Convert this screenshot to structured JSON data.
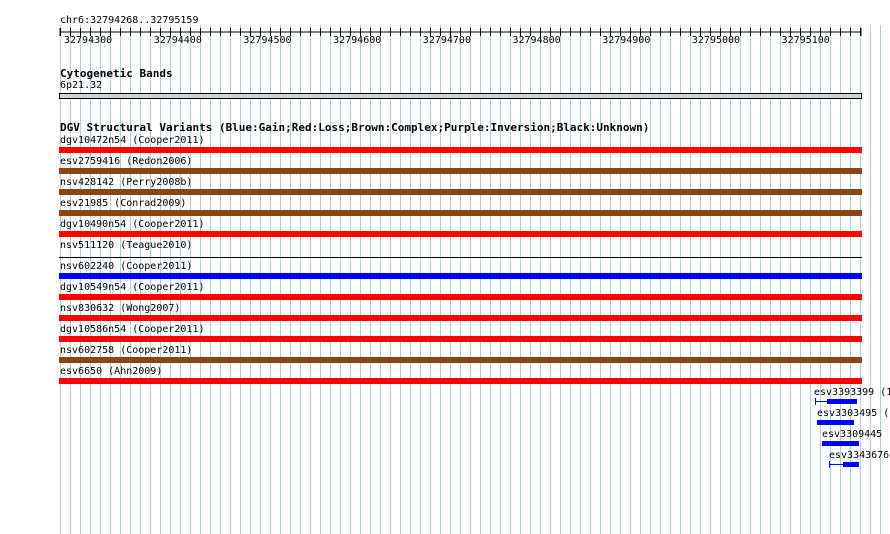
{
  "locus": "chr6:32794268..32795159",
  "ruler_ticks": [
    "32794300",
    "32794400",
    "32794500",
    "32794600",
    "32794700",
    "32794800",
    "32794900",
    "32795000",
    "32795100"
  ],
  "cytoband_track": {
    "title": "Cytogenetic Bands",
    "band": "6p21.32"
  },
  "dgv_track": {
    "title": "DGV Structural Variants (Blue:Gain;Red:Loss;Brown:Complex;Purple:Inversion;Black:Unknown)",
    "colors": {
      "gain": "#0000ff",
      "loss": "#ff0000",
      "complex": "#8b4513",
      "unknown": "#000000"
    },
    "variants": [
      {
        "label": "dgv10472n54 (Cooper2011)",
        "type": "loss"
      },
      {
        "label": "esv2759416 (Redon2006)",
        "type": "complex"
      },
      {
        "label": "nsv428142 (Perry2008b)",
        "type": "complex"
      },
      {
        "label": "esv21985 (Conrad2009)",
        "type": "complex"
      },
      {
        "label": "dgv10490n54 (Cooper2011)",
        "type": "loss"
      },
      {
        "label": "nsv511120 (Teague2010)",
        "type": "unknown"
      },
      {
        "label": "nsv602240 (Cooper2011)",
        "type": "gain"
      },
      {
        "label": "dgv10549n54 (Cooper2011)",
        "type": "loss"
      },
      {
        "label": "nsv830632 (Wong2007)",
        "type": "loss"
      },
      {
        "label": "dgv10586n54 (Cooper2011)",
        "type": "loss"
      },
      {
        "label": "nsv602758 (Cooper2011)",
        "type": "complex"
      },
      {
        "label": "esv6650 (Ahn2009)",
        "type": "loss"
      }
    ],
    "edge_features": [
      {
        "label": "esv3393399 (1"
      },
      {
        "label": "esv3303495 ("
      },
      {
        "label": "esv3309445 ("
      },
      {
        "label": "esv3343676"
      }
    ]
  }
}
